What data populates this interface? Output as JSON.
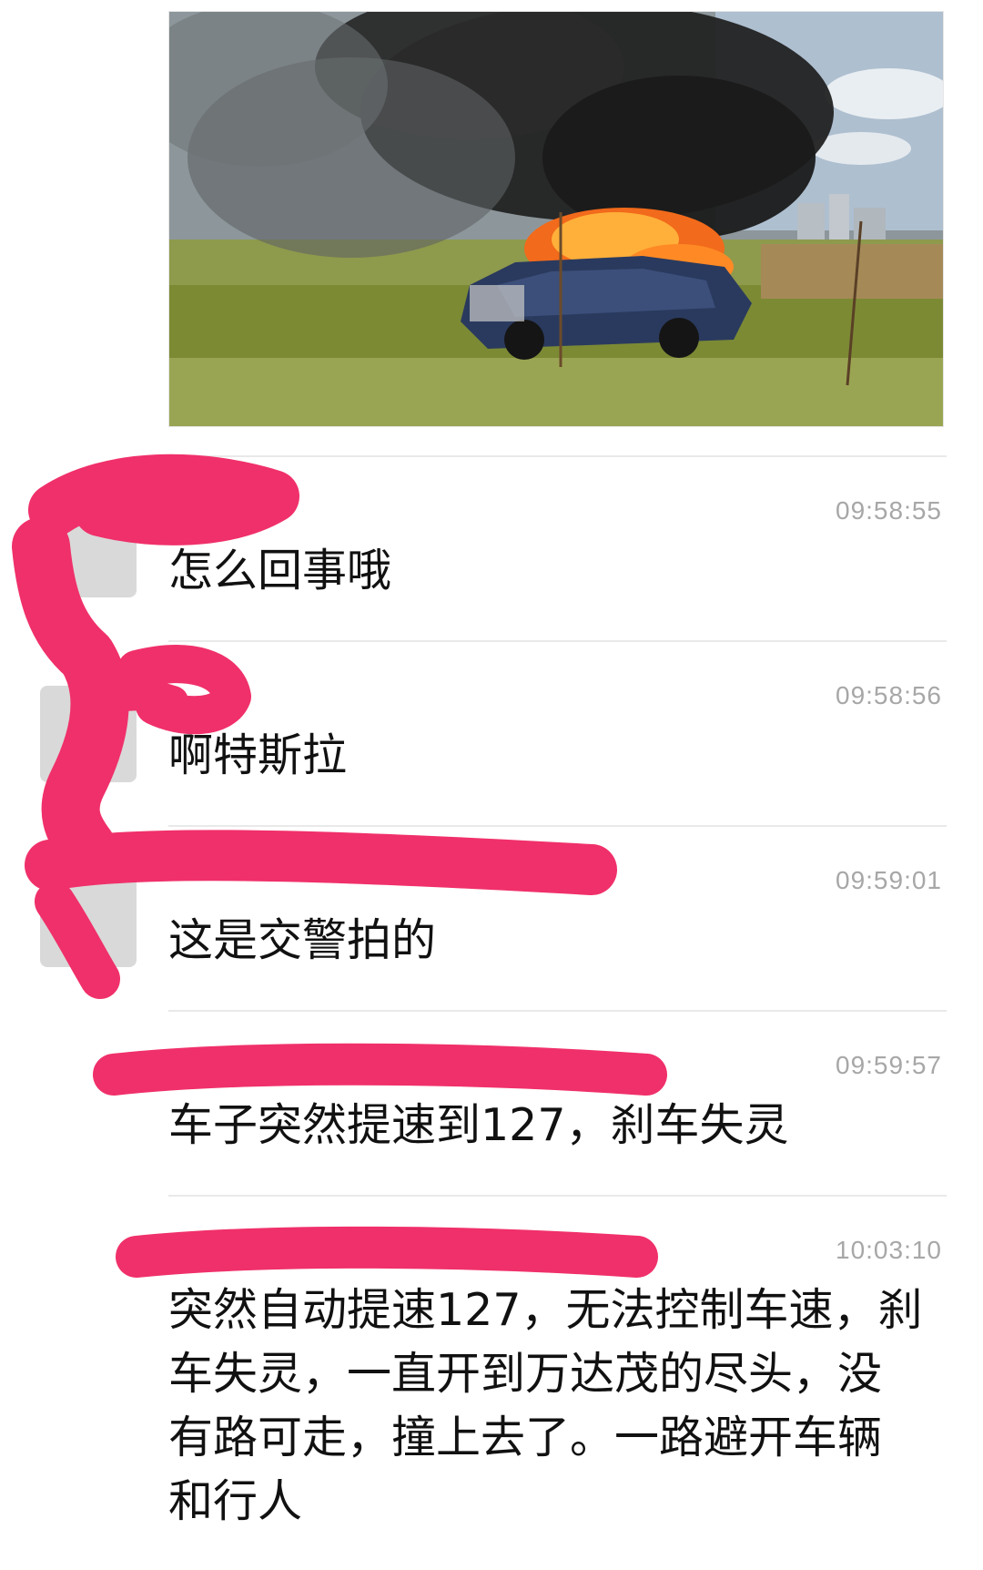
{
  "photo": {
    "subject": "burning-car-photo"
  },
  "messages": [
    {
      "sender": "",
      "time": "09:58:55",
      "text": "怎么回事哦"
    },
    {
      "sender": "",
      "time": "09:58:56",
      "text": "啊特斯拉"
    },
    {
      "sender": "",
      "time": "09:59:01",
      "text": "这是交警拍的"
    },
    {
      "sender": "",
      "time": "09:59:57",
      "text": "车子突然提速到127，刹车失灵"
    },
    {
      "sender": "",
      "time": "10:03:10",
      "text": "突然自动提速127，无法控制车速，刹车失灵，一直开到万达茂的尽头，没有路可走，撞上去了。一路避开车辆和行人"
    }
  ],
  "colors": {
    "redaction": "#f0306a",
    "divider": "#e9e9e9",
    "time_text": "#a7a7a7",
    "message_text": "#111111"
  }
}
